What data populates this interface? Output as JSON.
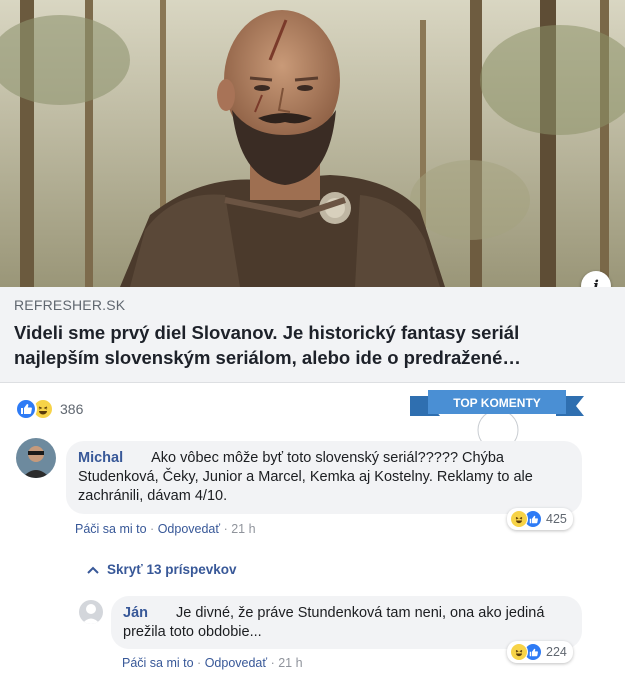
{
  "link_preview": {
    "domain": "REFRESHER.SK",
    "headline": "Videli sme prvý diel Slovanov. Je historický fantasy seriál najlepším slovenským seriálom, alebo ide o predražené…",
    "info_icon": "i"
  },
  "post_reactions": {
    "icons": [
      "like-icon",
      "haha-icon"
    ],
    "count": "386"
  },
  "top_comments_ribbon": "TOP KOMENTY",
  "comments": [
    {
      "author": "Michal",
      "text": "Ako vôbec môže byť toto slovenský seriál????? Chýba Studenková, Čeky, Junior a Marcel, Kemka aj Kostelny. Reklamy to ale zachránili, dávam 4/10.",
      "like_label": "Páči sa mi to",
      "reply_label": "Odpovedať",
      "separator": "·",
      "time": "21 h",
      "reaction_count": "425"
    }
  ],
  "hide_replies_label": "Skryť 13 príspevkov",
  "replies": [
    {
      "author": "Ján",
      "text": "Je divné, že práve Stundenková tam neni, ona ako jediná prežila toto obdobie...",
      "like_label": "Páči sa mi to",
      "reply_label": "Odpovedať",
      "separator": "·",
      "time": "21 h",
      "reaction_count": "224"
    }
  ],
  "colors": {
    "link_blue": "#385898",
    "bubble_bg": "#f2f3f5",
    "like_blue": "#2e7bf5",
    "haha_yellow": "#f7d348",
    "ribbon_blue": "#4a8fd4"
  }
}
